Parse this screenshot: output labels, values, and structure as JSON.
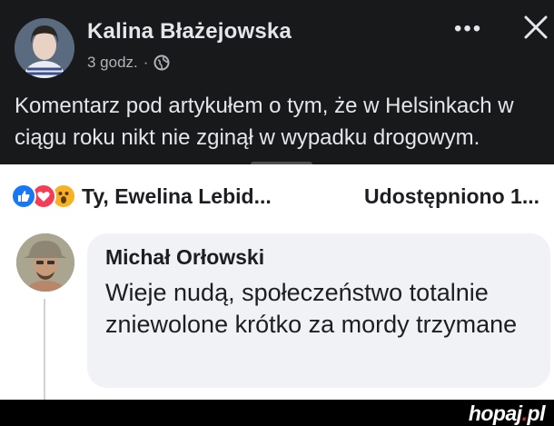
{
  "post": {
    "author_name": "Kalina Błażejowska",
    "time": "3 godz.",
    "separator": "·",
    "text": "Komentarz pod artykułem o tym, że w Helsinkach w ciągu roku nikt nie zginął w wypadku drogowym.",
    "icons": [
      "globe-icon",
      "more-icon",
      "close-icon"
    ]
  },
  "reactions": {
    "icons": [
      "like-icon",
      "love-icon",
      "wow-icon"
    ],
    "reactors_text": "Ty, Ewelina Lebid...",
    "shares_text": "Udostępniono 1..."
  },
  "comment": {
    "author_name": "Michał Orłowski",
    "text": "Wieje nudą, społeczeństwo totalnie zniewolone krótko za mordy trzymane"
  },
  "watermark": {
    "name": "hopaj",
    "dot": ".",
    "tld": "pl"
  },
  "colors": {
    "dark_bg": "#18191a",
    "like": "#1877f2",
    "love": "#f33e58",
    "wow": "#f7b125",
    "bubble": "#f0f2f5"
  }
}
